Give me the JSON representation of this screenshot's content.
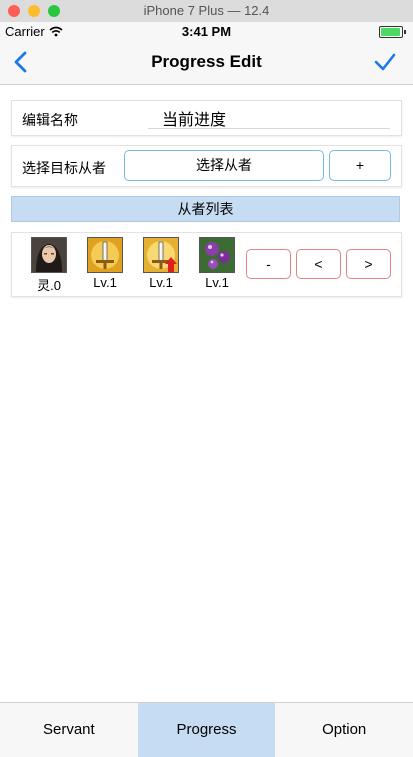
{
  "window": {
    "title": "iPhone 7 Plus — 12.4"
  },
  "status": {
    "carrier": "Carrier",
    "time": "3:41 PM"
  },
  "nav": {
    "title": "Progress Edit"
  },
  "form": {
    "name_label": "编辑名称",
    "name_value": "当前进度",
    "target_label": "选择目标从者",
    "select_button": "选择从者",
    "add_button": "+"
  },
  "list": {
    "header": "从者列表",
    "servants": [
      {
        "level": "灵.0"
      },
      {
        "level": "Lv.1"
      },
      {
        "level": "Lv.1"
      },
      {
        "level": "Lv.1"
      }
    ],
    "minus_button": "-",
    "prev_button": "<",
    "next_button": ">"
  },
  "tabs": [
    {
      "label": "Servant"
    },
    {
      "label": "Progress"
    },
    {
      "label": "Option"
    }
  ],
  "colors": {
    "accent": "#1d7ae5",
    "selected_tab": "#c6dcf3",
    "blue_border": "#77b7e4",
    "red_border": "#e08686"
  }
}
